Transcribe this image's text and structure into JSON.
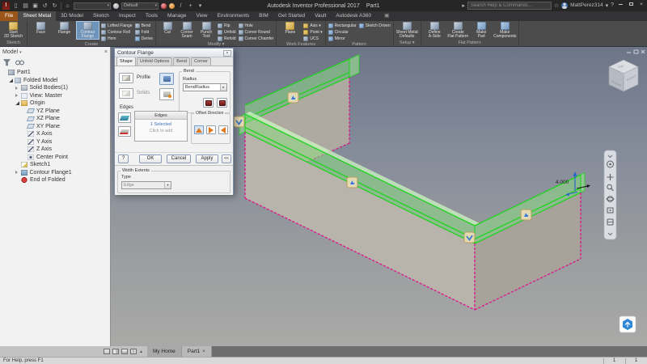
{
  "colors": {
    "ribbon_bg": "#4c4c4c",
    "tab_active": "#4c4c4c",
    "file_tab": "#9a5618",
    "highlight_button": "#6f94ba",
    "preview_magenta": "#e0108e",
    "highlight_green": "#25d625",
    "canvas_top": "#6d7588",
    "canvas_bottom": "#a9a9a7"
  },
  "titlebar": {
    "app_title": "Autodesk Inventor Professional 2017",
    "doc_title": "Part1",
    "search_placeholder": "Search Help & Commands...",
    "user_name": "MattPerez314",
    "material_value": "",
    "appearance_value": "Default",
    "qat_icons": [
      {
        "name": "new-file-icon",
        "glyph": "▯"
      },
      {
        "name": "open-icon",
        "glyph": "▤"
      },
      {
        "name": "save-icon",
        "glyph": "▣"
      },
      {
        "name": "undo-icon",
        "glyph": "↺"
      },
      {
        "name": "redo-icon",
        "glyph": "↻"
      },
      {
        "name": "home-icon",
        "glyph": "⌂"
      }
    ],
    "right_icons": [
      {
        "name": "favorites-star-icon",
        "glyph": "☆"
      },
      {
        "name": "help-icon",
        "glyph": "?"
      }
    ]
  },
  "ribbon": {
    "tabs": [
      {
        "label": "File",
        "file": true
      },
      {
        "label": "Sheet Metal",
        "active": true
      },
      {
        "label": "3D Model"
      },
      {
        "label": "Sketch"
      },
      {
        "label": "Inspect"
      },
      {
        "label": "Tools"
      },
      {
        "label": "Manage"
      },
      {
        "label": "View"
      },
      {
        "label": "Environments"
      },
      {
        "label": "BIM"
      },
      {
        "label": "Get Started"
      },
      {
        "label": "Vault"
      },
      {
        "label": "Autodesk A360"
      }
    ],
    "panels": [
      {
        "name": "Sketch",
        "groups": [
          {
            "type": "big",
            "buttons": [
              {
                "label": "Start\n2D Sketch",
                "icon": "ic-gold"
              }
            ]
          }
        ]
      },
      {
        "name": "Create",
        "groups": [
          {
            "type": "big",
            "buttons": [
              {
                "label": "Face",
                "icon": "ic-metal"
              },
              {
                "label": "Flange",
                "icon": "ic-metal"
              },
              {
                "label": "Contour\nFlange",
                "icon": "ic-metal",
                "hl": true
              }
            ]
          },
          {
            "type": "small",
            "buttons": [
              {
                "label": "Lofted Flange",
                "icon": "ic-metal"
              },
              {
                "label": "Contour Roll",
                "icon": "ic-metal"
              },
              {
                "label": "Hem",
                "icon": "ic-metal"
              }
            ]
          },
          {
            "type": "small",
            "buttons": [
              {
                "label": "Bend",
                "icon": "ic-metal"
              },
              {
                "label": "Fold",
                "icon": "ic-metal"
              },
              {
                "label": "Derive",
                "icon": "ic-blue"
              }
            ]
          }
        ]
      },
      {
        "name": "Modify ▾",
        "groups": [
          {
            "type": "med",
            "buttons": [
              {
                "label": "Cut",
                "icon": "ic-metal"
              },
              {
                "label": "Corner\nSeam",
                "icon": "ic-metal"
              },
              {
                "label": "Punch\nTool",
                "icon": "ic-metal"
              }
            ]
          },
          {
            "type": "small",
            "buttons": [
              {
                "label": "Rip",
                "icon": "ic-metal"
              },
              {
                "label": "Unfold",
                "icon": "ic-metal"
              },
              {
                "label": "Refold",
                "icon": "ic-metal"
              }
            ]
          },
          {
            "type": "small",
            "buttons": [
              {
                "label": "Hole",
                "icon": "ic-metal"
              },
              {
                "label": "Corner Round",
                "icon": "ic-metal"
              },
              {
                "label": "Corner Chamfer",
                "icon": "ic-metal"
              }
            ]
          }
        ]
      },
      {
        "name": "Work Features",
        "groups": [
          {
            "type": "big",
            "buttons": [
              {
                "label": "Plane",
                "icon": "ic-gold"
              }
            ]
          },
          {
            "type": "small",
            "buttons": [
              {
                "label": "Axis ▾",
                "icon": "ic-gold"
              },
              {
                "label": "Point ▾",
                "icon": "ic-gold"
              },
              {
                "label": "UCS",
                "icon": "ic-metal"
              }
            ]
          }
        ]
      },
      {
        "name": "Pattern",
        "groups": [
          {
            "type": "small",
            "buttons": [
              {
                "label": "Rectangular",
                "icon": "ic-blue"
              },
              {
                "label": "Circular",
                "icon": "ic-blue"
              },
              {
                "label": "Mirror",
                "icon": "ic-blue"
              }
            ]
          },
          {
            "type": "small",
            "buttons": [
              {
                "label": "Sketch Driven",
                "icon": "ic-blue"
              }
            ]
          }
        ]
      },
      {
        "name": "Setup ▾",
        "groups": [
          {
            "type": "big",
            "buttons": [
              {
                "label": "Sheet Metal\nDefaults",
                "icon": "ic-metal"
              }
            ]
          }
        ]
      },
      {
        "name": "Flat Pattern",
        "groups": [
          {
            "type": "big",
            "buttons": [
              {
                "label": "Define\nA-Side",
                "icon": "ic-metal"
              },
              {
                "label": "Create\nFlat Pattern",
                "icon": "ic-metal"
              },
              {
                "label": "Make\nPart",
                "icon": "ic-blue"
              },
              {
                "label": "Make\nComponents",
                "icon": "ic-blue"
              }
            ]
          }
        ]
      }
    ]
  },
  "browser": {
    "title": "Model",
    "tree": [
      {
        "label": "Part1",
        "indent": 0,
        "icon": "part",
        "exp": ""
      },
      {
        "label": "Folded Model",
        "indent": 1,
        "icon": "folded",
        "exp": "e"
      },
      {
        "label": "Solid Bodies(1)",
        "indent": 2,
        "icon": "solid",
        "exp": "c"
      },
      {
        "label": "View: Master",
        "indent": 2,
        "icon": "view",
        "exp": "c"
      },
      {
        "label": "Origin",
        "indent": 2,
        "icon": "origin",
        "exp": "e"
      },
      {
        "label": "YZ Plane",
        "indent": 3,
        "icon": "plane",
        "exp": ""
      },
      {
        "label": "XZ Plane",
        "indent": 3,
        "icon": "plane",
        "exp": ""
      },
      {
        "label": "XY Plane",
        "indent": 3,
        "icon": "plane",
        "exp": ""
      },
      {
        "label": "X Axis",
        "indent": 3,
        "icon": "axis",
        "exp": ""
      },
      {
        "label": "Y Axis",
        "indent": 3,
        "icon": "axis",
        "exp": ""
      },
      {
        "label": "Z Axis",
        "indent": 3,
        "icon": "axis",
        "exp": ""
      },
      {
        "label": "Center Point",
        "indent": 3,
        "icon": "point",
        "exp": ""
      },
      {
        "label": "Sketch1",
        "indent": 2,
        "icon": "sketch",
        "exp": ""
      },
      {
        "label": "Contour Flange1",
        "indent": 2,
        "icon": "cflange",
        "exp": "c"
      },
      {
        "label": "End of Folded",
        "indent": 2,
        "icon": "eof",
        "exp": ""
      }
    ]
  },
  "dialog": {
    "title": "Contour Flange",
    "tabs": [
      "Shape",
      "Unfold Options",
      "Bend",
      "Corner"
    ],
    "active_tab": "Shape",
    "profile_label": "Profile",
    "solids_label": "Solids",
    "bend_group": "Bend",
    "radius_label": "Radius",
    "radius_value": "BendRadius",
    "edges_label": "Edges",
    "edges_list_header": "Edges",
    "edges_selected": "1 Selected",
    "edges_add": "Click to add",
    "offset_group": "Offset Direction",
    "help_label": "?",
    "ok_label": "OK",
    "cancel_label": "Cancel",
    "apply_label": "Apply",
    "more_label": "<<",
    "width_extents_group": "Width Extents",
    "type_label": "Type",
    "type_value": "Edge"
  },
  "canvas": {
    "dimension": "4.000",
    "viewcube": {
      "top": "TOP",
      "front": "FRONT",
      "right": "RIGHT"
    }
  },
  "docbar": {
    "tabs": [
      {
        "label": "My Home"
      },
      {
        "label": "Part1",
        "active": true,
        "closable": true
      }
    ]
  },
  "statusbar": {
    "help": "For Help, press F1",
    "cells": [
      "1",
      "1"
    ]
  }
}
